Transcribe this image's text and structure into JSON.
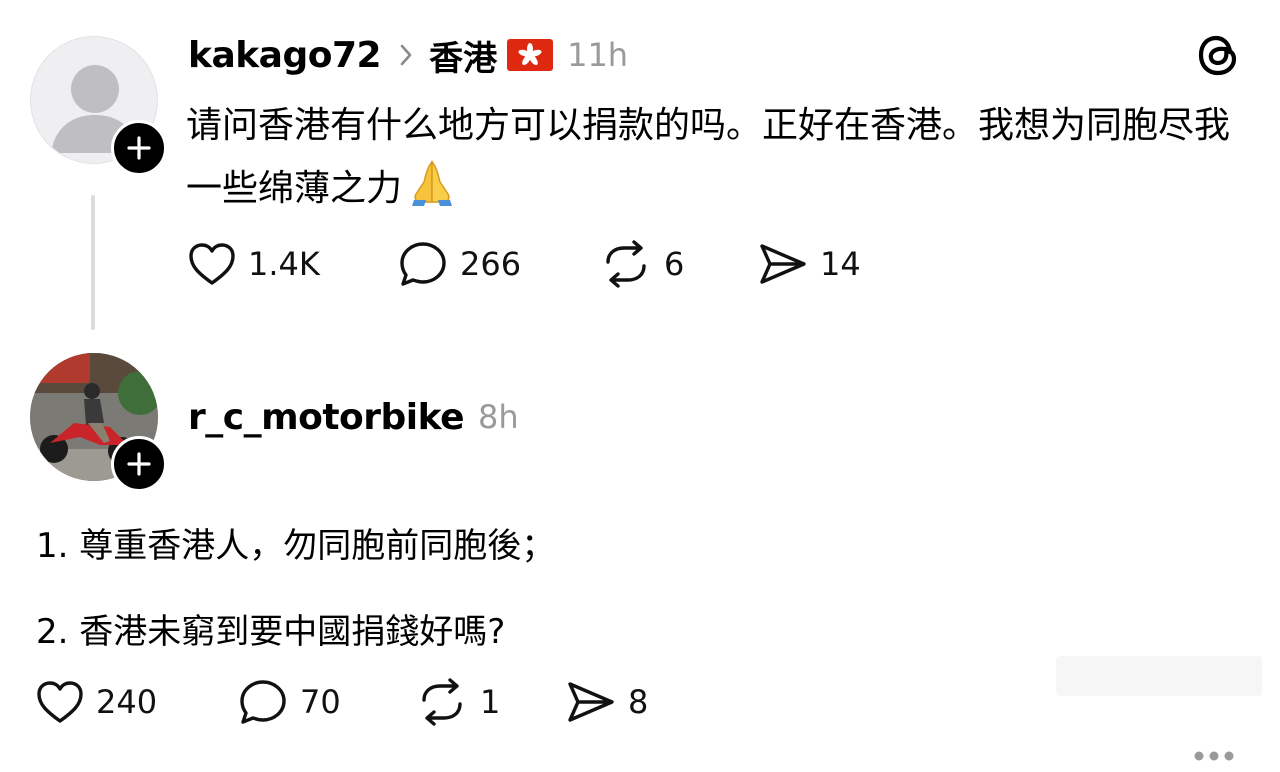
{
  "post1": {
    "username": "kakago72",
    "topic": "香港",
    "time": "11h",
    "text": "请问香港有什么地方可以捐款的吗。正好在香港。我想为同胞尽我一些绵薄之力",
    "emoji_icon": "folded-hands-emoji",
    "flag_icon": "hong-kong-flag",
    "likes": "1.4K",
    "comments": "266",
    "reposts": "6",
    "shares": "14"
  },
  "post2": {
    "username": "r_c_motorbike",
    "time": "8h",
    "lines": [
      "1. 尊重香港人，勿同胞前同胞後；",
      "2. 香港未窮到要中國捐錢好嗎?"
    ],
    "likes": "240",
    "comments": "70",
    "reposts": "1",
    "shares": "8"
  },
  "colors": {
    "text": "#000000",
    "muted": "#9a9a9a",
    "thread_line": "#dcdcdc",
    "hk_red": "#de2910"
  }
}
